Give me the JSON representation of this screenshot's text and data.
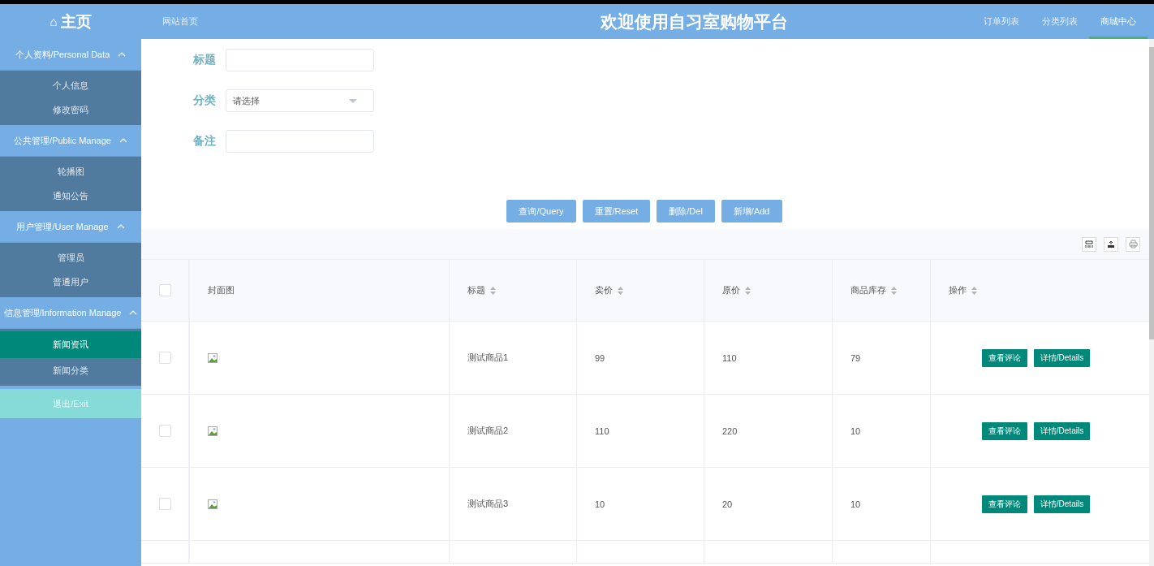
{
  "header": {
    "logo": "⌂",
    "title": "主页",
    "site_link": "网站首页",
    "banner": "欢迎使用自习室购物平台",
    "nav": [
      {
        "label": "订单列表",
        "selected": false
      },
      {
        "label": "分类列表",
        "selected": false
      },
      {
        "label": "商城中心",
        "selected": true
      }
    ]
  },
  "sidebar": {
    "groups": [
      {
        "label": "个人资料/Personal Data",
        "expanded": true,
        "items": [
          {
            "label": "个人信息",
            "selected": false
          },
          {
            "label": "修改密码",
            "selected": false
          }
        ]
      },
      {
        "label": "公共管理/Public Manage",
        "expanded": true,
        "items": [
          {
            "label": "轮播图",
            "selected": false
          },
          {
            "label": "通知公告",
            "selected": false
          }
        ]
      },
      {
        "label": "用户管理/User Manage",
        "expanded": true,
        "items": [
          {
            "label": "管理员",
            "selected": false
          },
          {
            "label": "普通用户",
            "selected": false
          }
        ]
      },
      {
        "label": "信息管理/Information Manage",
        "expanded": true,
        "items": [
          {
            "label": "新闻资讯",
            "selected": true
          },
          {
            "label": "新闻分类",
            "selected": false
          }
        ]
      }
    ],
    "exit": "退出/Exit"
  },
  "form": {
    "fields": [
      {
        "label": "标题",
        "kind": "text"
      },
      {
        "label": "分类",
        "kind": "select",
        "placeholder": "请选择"
      },
      {
        "label": "备注",
        "kind": "text"
      }
    ]
  },
  "buttons": [
    "查询/Query",
    "重置/Reset",
    "删除/Del",
    "新增/Add"
  ],
  "table": {
    "select_all": {
      "checked": false
    },
    "columns": [
      {
        "label": "封面图",
        "sortable": false
      },
      {
        "label": "标题",
        "sortable": true
      },
      {
        "label": "卖价",
        "sortable": true
      },
      {
        "label": "原价",
        "sortable": true
      },
      {
        "label": "商品库存",
        "sortable": true
      },
      {
        "label": "操作",
        "sortable": true
      }
    ],
    "rows": [
      {
        "selected": false,
        "title": "测试商品1",
        "price": "99",
        "original_price": "110",
        "stock": "79",
        "actions": [
          "查看评论",
          "详情/Details"
        ]
      },
      {
        "selected": false,
        "title": "测试商品2",
        "price": "110",
        "original_price": "220",
        "stock": "10",
        "actions": [
          "查看评论",
          "详情/Details"
        ]
      },
      {
        "selected": false,
        "title": "测试商品3",
        "price": "10",
        "original_price": "20",
        "stock": "10",
        "actions": [
          "查看评论",
          "详情/Details"
        ]
      }
    ]
  }
}
